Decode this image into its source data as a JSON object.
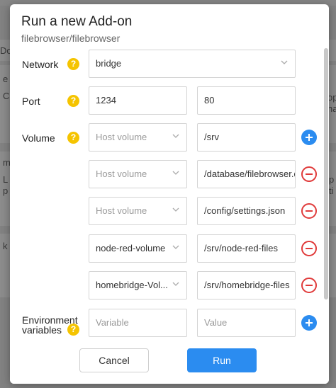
{
  "background": {
    "tab_text": "Do",
    "right_text_1": "op",
    "right_text_2": "na",
    "right_text_3": "p",
    "right_text_4": "ti",
    "left_chars": [
      "e",
      "C",
      "m",
      "L",
      "p",
      "k"
    ]
  },
  "modal": {
    "title": "Run a new Add-on",
    "subtitle": "filebrowser/filebrowser",
    "network": {
      "label": "Network",
      "value": "bridge"
    },
    "port": {
      "label": "Port",
      "host": "1234",
      "container": "80"
    },
    "volume": {
      "label": "Volume",
      "rows": [
        {
          "host": "Host volume",
          "host_placeholder": true,
          "container": "/srv",
          "action": "add"
        },
        {
          "host": "Host volume",
          "host_placeholder": true,
          "container": "/database/filebrowser.d",
          "action": "remove"
        },
        {
          "host": "Host volume",
          "host_placeholder": true,
          "container": "/config/settings.json",
          "action": "remove"
        },
        {
          "host": "node-red-volume",
          "host_placeholder": false,
          "container": "/srv/node-red-files",
          "action": "remove"
        },
        {
          "host": "homebridge-Vol...",
          "host_placeholder": false,
          "container": "/srv/homebridge-files",
          "action": "remove"
        }
      ]
    },
    "env": {
      "label_line1": "Environment",
      "label_line2": "variables",
      "variable_placeholder": "Variable",
      "value_placeholder": "Value"
    },
    "buttons": {
      "cancel": "Cancel",
      "run": "Run"
    }
  },
  "colors": {
    "accent": "#2b8cf0",
    "help": "#f5c400",
    "remove": "#e03a3a"
  }
}
